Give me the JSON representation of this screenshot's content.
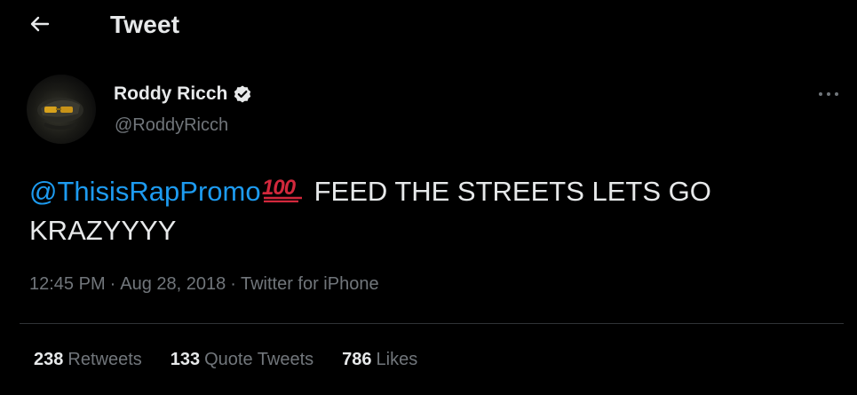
{
  "header": {
    "title": "Tweet"
  },
  "author": {
    "display_name": "Roddy Ricch",
    "handle": "@RoddyRicch",
    "verified": true
  },
  "tweet": {
    "mention": "@ThisisRapPromo",
    "emoji": "hundred-points",
    "text": "FEED THE STREETS LETS GO KRAZYYYY"
  },
  "meta": {
    "time": "12:45 PM",
    "separator": "·",
    "date": "Aug 28, 2018",
    "source": "Twitter for iPhone"
  },
  "stats": {
    "retweets": {
      "count": "238",
      "label": "Retweets"
    },
    "quotes": {
      "count": "133",
      "label": "Quote Tweets"
    },
    "likes": {
      "count": "786",
      "label": "Likes"
    }
  },
  "colors": {
    "background": "#000000",
    "text": "#e7e9ea",
    "secondary": "#71767b",
    "link": "#1d9bf0",
    "divider": "#2f3336",
    "emoji_red": "#d2283c"
  }
}
